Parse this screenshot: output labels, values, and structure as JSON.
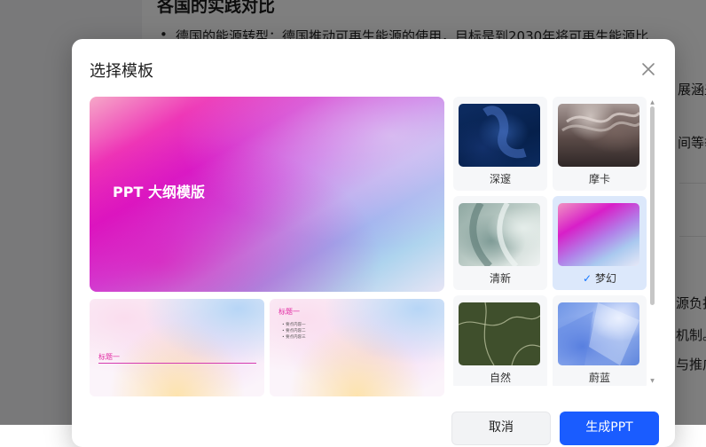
{
  "document": {
    "heading": "各国的实践对比",
    "bullet": "德国的能源转型：德国推动可再生能源的使用，目标是到2030年将可再生能源比",
    "fragments": [
      "展涵盖",
      "间等举",
      "源负担",
      "机制。",
      "与推广"
    ]
  },
  "modal": {
    "title": "选择模板",
    "close_icon": "close-icon",
    "preview": {
      "main_title": "PPT 大纲模版",
      "thumb1_title": "标题一",
      "thumb2_title": "标题一",
      "thumb2_bullets": [
        "要点内容一",
        "要点内容二",
        "要点内容三"
      ]
    },
    "templates": [
      {
        "label": "深邃",
        "selected": false
      },
      {
        "label": "摩卡",
        "selected": false
      },
      {
        "label": "清新",
        "selected": false
      },
      {
        "label": "梦幻",
        "selected": true
      },
      {
        "label": "自然",
        "selected": false
      },
      {
        "label": "蔚蓝",
        "selected": false
      }
    ],
    "buttons": {
      "cancel": "取消",
      "generate": "生成PPT"
    },
    "colors": {
      "primary": "#1a5cff",
      "selected_card": "#dce8fb"
    }
  }
}
